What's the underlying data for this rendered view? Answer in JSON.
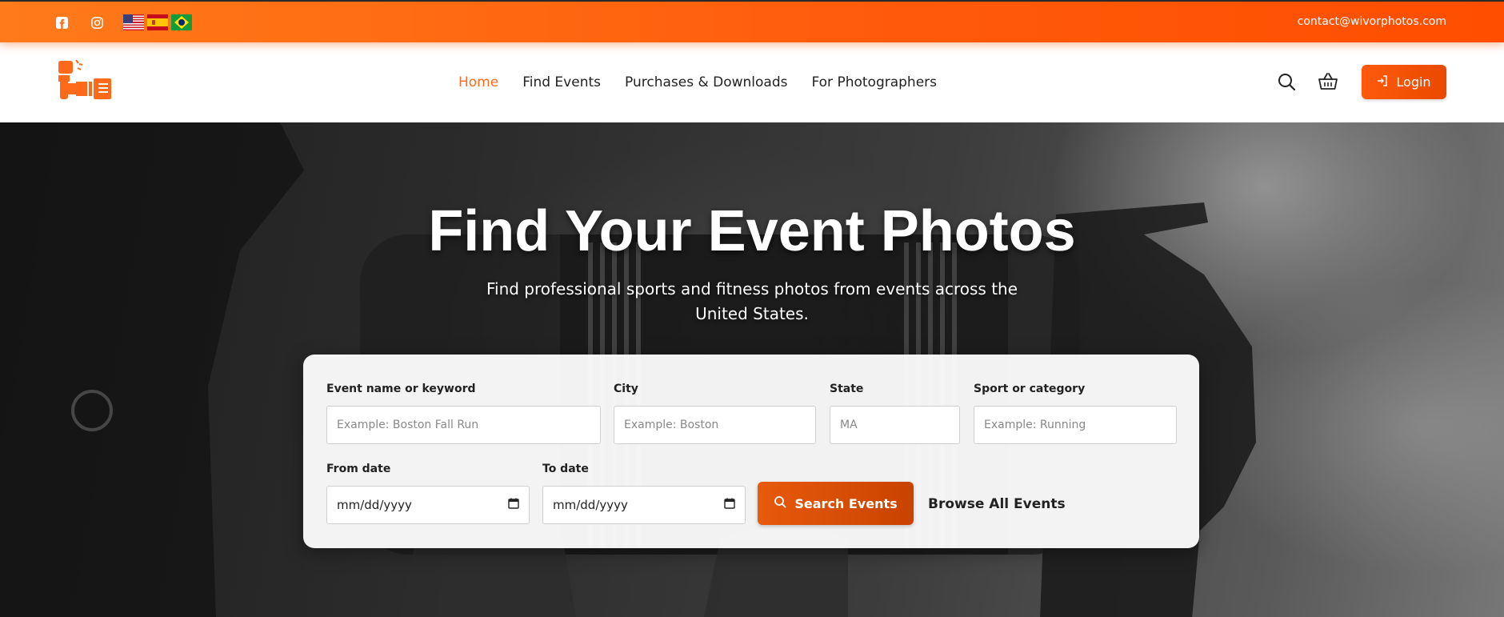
{
  "topbar": {
    "icons": {
      "facebook": "facebook-icon",
      "instagram": "instagram-icon"
    },
    "languages": [
      {
        "code": "en",
        "icon": "flag-us-icon"
      },
      {
        "code": "es",
        "icon": "flag-es-icon"
      },
      {
        "code": "pt",
        "icon": "flag-br-icon"
      }
    ],
    "contact_email": "contact@wivorphotos.com"
  },
  "nav": {
    "items": [
      {
        "label": "Home",
        "active": true
      },
      {
        "label": "Find Events",
        "active": false
      },
      {
        "label": "Purchases & Downloads",
        "active": false
      },
      {
        "label": "For Photographers",
        "active": false
      }
    ],
    "search_icon": "search-icon",
    "cart_icon": "basket-icon",
    "login_label": "Login",
    "login_icon": "login-icon"
  },
  "hero": {
    "title": "Find Your Event Photos",
    "subtitle": "Find professional sports and fitness photos from events across the United States."
  },
  "search_form": {
    "keyword": {
      "label": "Event name or keyword",
      "placeholder": "Example: Boston Fall Run",
      "value": ""
    },
    "city": {
      "label": "City",
      "placeholder": "Example: Boston",
      "value": ""
    },
    "state": {
      "label": "State",
      "placeholder": "MA",
      "value": ""
    },
    "sport": {
      "label": "Sport or category",
      "placeholder": "Example: Running",
      "value": ""
    },
    "from_date": {
      "label": "From date",
      "placeholder": "mm/dd/yyyy",
      "value": ""
    },
    "to_date": {
      "label": "To date",
      "placeholder": "mm/dd/yyyy",
      "value": ""
    },
    "submit_label": "Search Events",
    "browse_label": "Browse All Events"
  },
  "colors": {
    "brand_orange": "#ff5a0a",
    "active_link": "#ff6a1a",
    "search_button": "#d44e06",
    "text_dark": "#222222"
  }
}
